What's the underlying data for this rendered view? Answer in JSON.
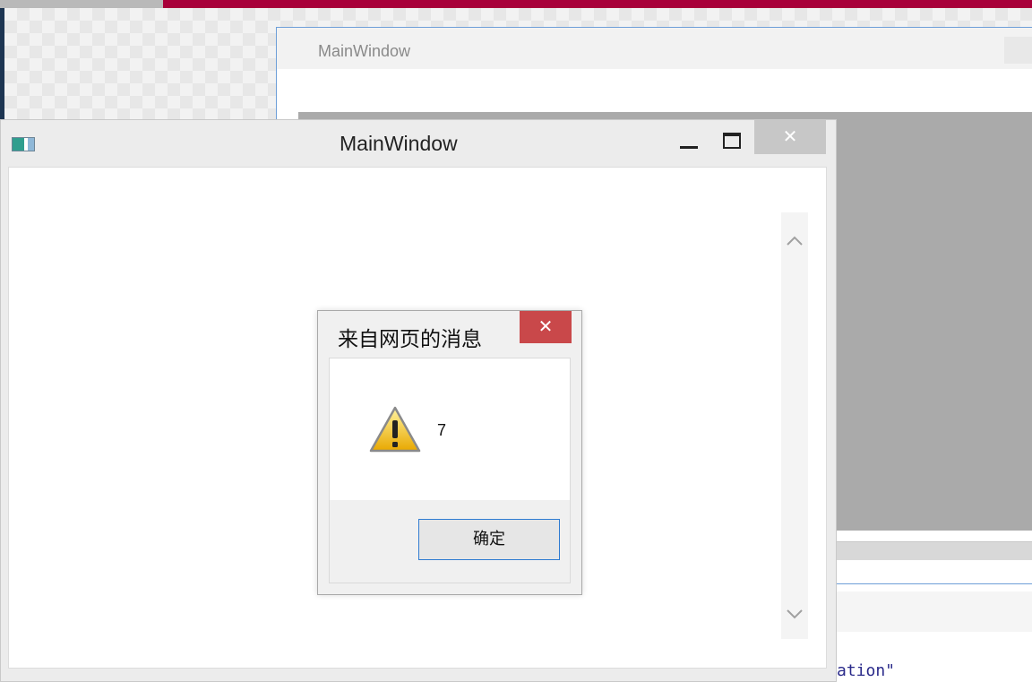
{
  "designer": {
    "preview_title": "MainWindow",
    "code_fragment": "ation\""
  },
  "main_window": {
    "title": "MainWindow",
    "close_glyph": "✕"
  },
  "message_box": {
    "title": "来自网页的消息",
    "close_glyph": "✕",
    "message": "7",
    "ok_label": "确定",
    "icon": "warning-icon"
  },
  "colors": {
    "accent_red": "#a8003a",
    "dialog_close": "#c9484a",
    "button_focus_border": "#2e7bd1"
  }
}
